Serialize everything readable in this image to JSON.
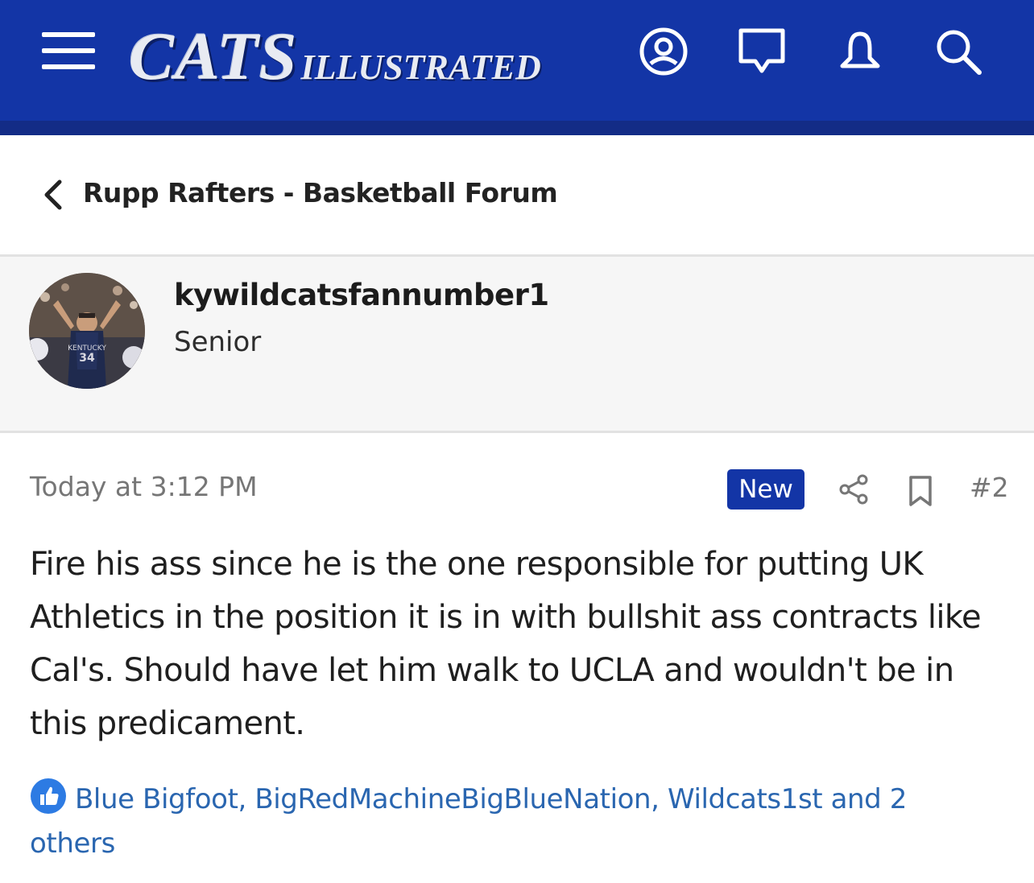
{
  "header": {
    "logo_main": "CATS",
    "logo_sub": "ILLUSTRATED",
    "colors": {
      "bar": "#1335a6",
      "strip": "#132c86"
    },
    "icons": [
      "menu-icon",
      "user-icon",
      "messages-icon",
      "alerts-icon",
      "search-icon"
    ]
  },
  "breadcrumb": {
    "label": "Rupp Rafters - Basketball Forum"
  },
  "author": {
    "username": "kywildcatsfannumber1",
    "title": "Senior"
  },
  "post": {
    "timestamp": "Today at 3:12 PM",
    "badge": "New",
    "number": "#2",
    "body": "Fire his ass since he is the one responsible for putting UK Athletics in the position it is in with bullshit ass contracts like Cal's. Should have let him walk to UCLA and wouldn't be in this predicament."
  },
  "reactions": {
    "text": "Blue Bigfoot, BigRedMachineBigBlueNation, Wildcats1st and 2 others",
    "icon": "like-icon",
    "color": "#2a66b0"
  }
}
